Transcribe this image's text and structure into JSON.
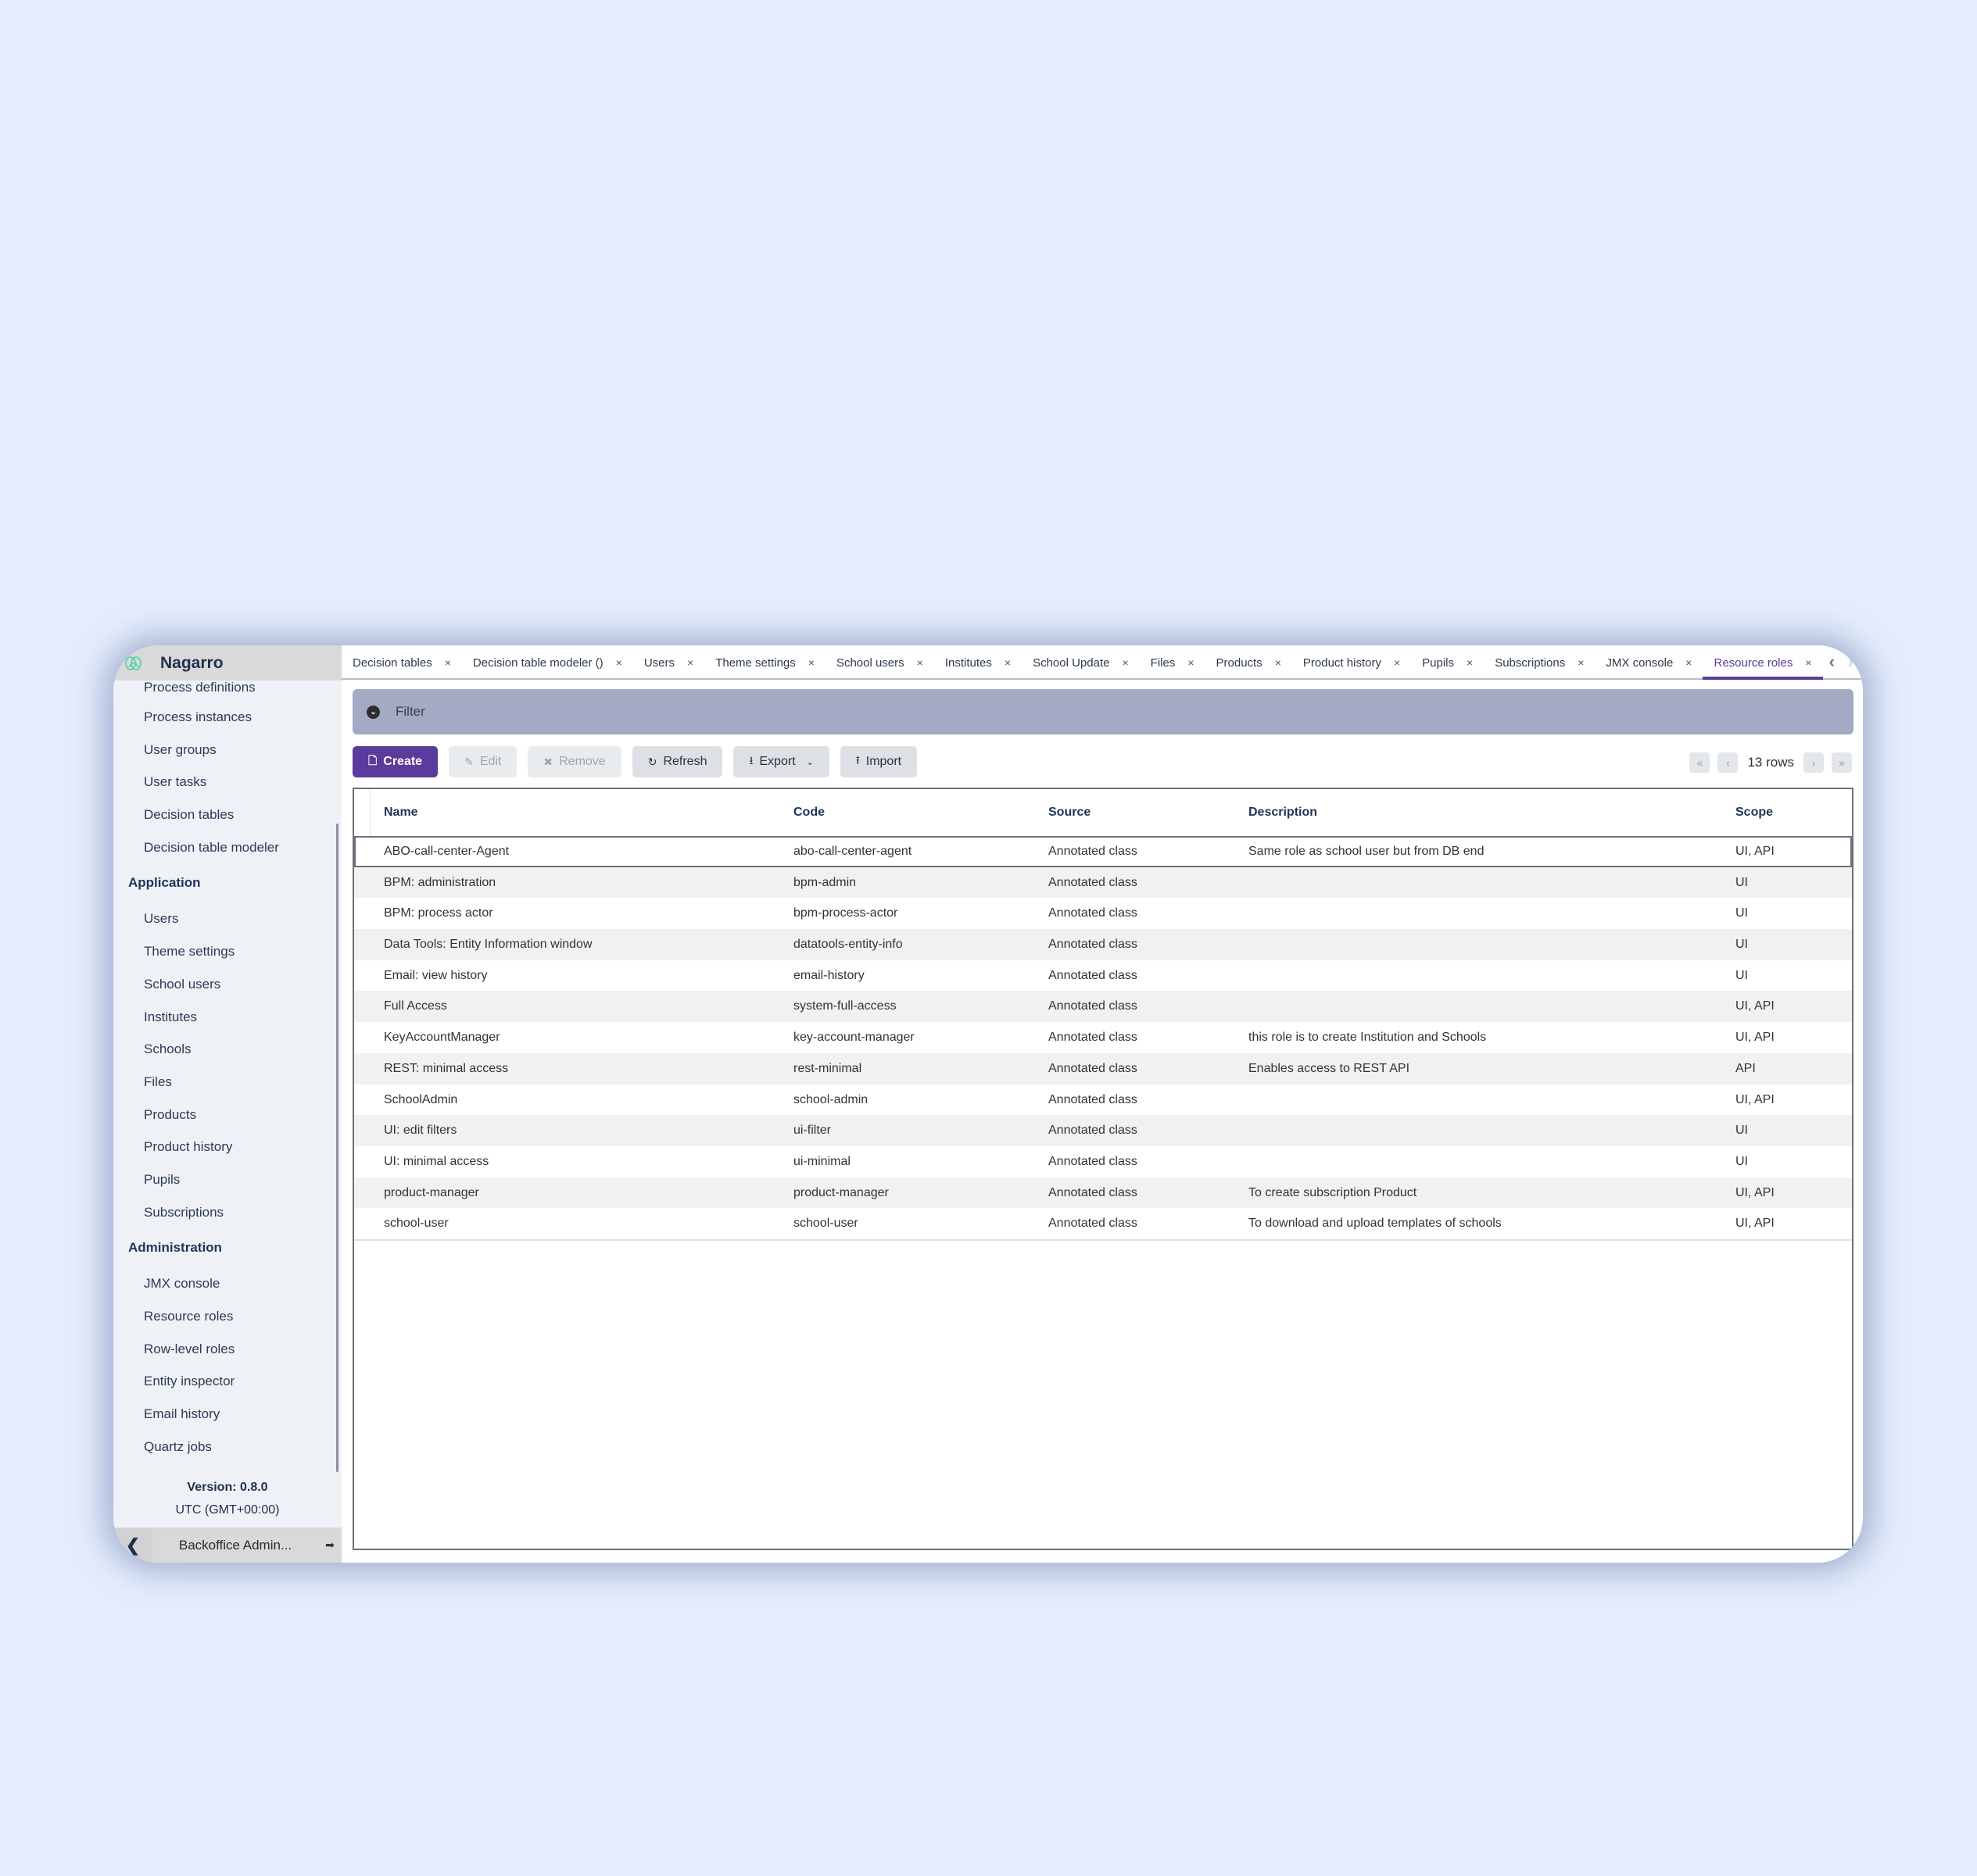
{
  "brand": {
    "name": "Nagarro",
    "logo_icon": "nagarro-logo-icon"
  },
  "sidebar": {
    "items_top": [
      "Process definitions",
      "Process instances",
      "User groups",
      "User tasks",
      "Decision tables",
      "Decision table modeler"
    ],
    "groups": [
      {
        "label": "Application",
        "items": [
          "Users",
          "Theme settings",
          "School users",
          "Institutes",
          "Schools",
          "Files",
          "Products",
          "Product history",
          "Pupils",
          "Subscriptions"
        ]
      },
      {
        "label": "Administration",
        "items": [
          "JMX console",
          "Resource roles",
          "Row-level roles",
          "Entity inspector",
          "Email history",
          "Quartz jobs"
        ]
      }
    ],
    "version": "Version: 0.8.0",
    "timezone": "UTC (GMT+00:00)",
    "user": "Backoffice Admin...",
    "collapse_icon": "chevron-left-icon",
    "logout_icon": "logout-icon"
  },
  "tabs": [
    {
      "label": "Decision tables",
      "active": false
    },
    {
      "label": "Decision table modeler ()",
      "active": false
    },
    {
      "label": "Users",
      "active": false
    },
    {
      "label": "Theme settings",
      "active": false
    },
    {
      "label": "School users",
      "active": false
    },
    {
      "label": "Institutes",
      "active": false
    },
    {
      "label": "School Update",
      "active": false
    },
    {
      "label": "Files",
      "active": false
    },
    {
      "label": "Products",
      "active": false
    },
    {
      "label": "Product history",
      "active": false
    },
    {
      "label": "Pupils",
      "active": false
    },
    {
      "label": "Subscriptions",
      "active": false
    },
    {
      "label": "JMX console",
      "active": false
    },
    {
      "label": "Resource roles",
      "active": true
    }
  ],
  "tab_close_glyph": "×",
  "filter": {
    "label": "Filter"
  },
  "toolbar": {
    "create": "Create",
    "edit": "Edit",
    "remove": "Remove",
    "refresh": "Refresh",
    "export": "Export",
    "import": "Import"
  },
  "pager": {
    "rows_label": "13 rows"
  },
  "table": {
    "columns": [
      "Name",
      "Code",
      "Source",
      "Description",
      "Scope"
    ],
    "rows": [
      {
        "name": "ABO-call-center-Agent",
        "code": "abo-call-center-agent",
        "source": "Annotated class",
        "description": "Same role as school user but from DB end",
        "scope": "UI, API"
      },
      {
        "name": "BPM: administration",
        "code": "bpm-admin",
        "source": "Annotated class",
        "description": "",
        "scope": "UI"
      },
      {
        "name": "BPM: process actor",
        "code": "bpm-process-actor",
        "source": "Annotated class",
        "description": "",
        "scope": "UI"
      },
      {
        "name": "Data Tools: Entity Information window",
        "code": "datatools-entity-info",
        "source": "Annotated class",
        "description": "",
        "scope": "UI"
      },
      {
        "name": "Email: view history",
        "code": "email-history",
        "source": "Annotated class",
        "description": "",
        "scope": "UI"
      },
      {
        "name": "Full Access",
        "code": "system-full-access",
        "source": "Annotated class",
        "description": "",
        "scope": "UI, API"
      },
      {
        "name": "KeyAccountManager",
        "code": "key-account-manager",
        "source": "Annotated class",
        "description": "this role is to create Institution and Schools",
        "scope": "UI, API"
      },
      {
        "name": "REST: minimal access",
        "code": "rest-minimal",
        "source": "Annotated class",
        "description": "Enables access to REST API",
        "scope": "API"
      },
      {
        "name": "SchoolAdmin",
        "code": "school-admin",
        "source": "Annotated class",
        "description": "",
        "scope": "UI, API"
      },
      {
        "name": "UI: edit filters",
        "code": "ui-filter",
        "source": "Annotated class",
        "description": "",
        "scope": "UI"
      },
      {
        "name": "UI: minimal access",
        "code": "ui-minimal",
        "source": "Annotated class",
        "description": "",
        "scope": "UI"
      },
      {
        "name": "product-manager",
        "code": "product-manager",
        "source": "Annotated class",
        "description": "To create subscription Product",
        "scope": "UI, API"
      },
      {
        "name": "school-user",
        "code": "school-user",
        "source": "Annotated class",
        "description": "To download and upload templates of schools",
        "scope": "UI, API"
      }
    ],
    "selected_row": 0
  },
  "colors": {
    "accent": "#5b3b9b",
    "filter_bar": "#a2abc3",
    "page_background": "#e4edfc",
    "sidebar_background": "#eef2f7"
  }
}
